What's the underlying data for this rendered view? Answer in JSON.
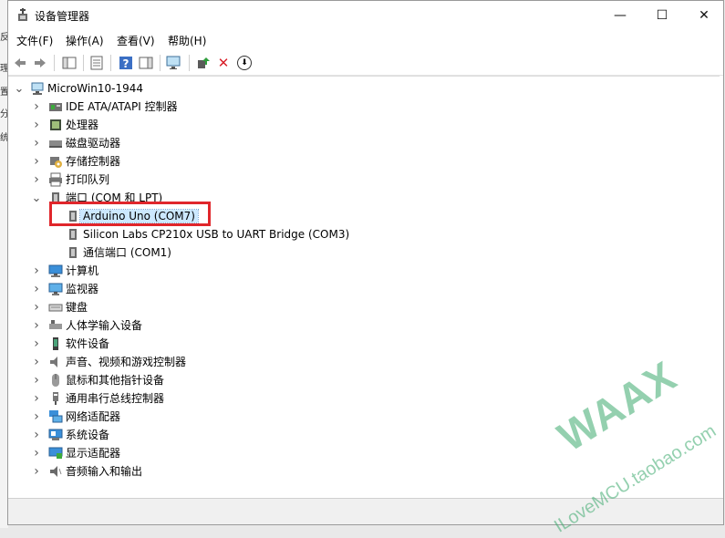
{
  "window": {
    "title": "设备管理器"
  },
  "controls": {
    "minimize": "—",
    "maximize": "☐",
    "close": "✕"
  },
  "menu": [
    "文件(F)",
    "操作(A)",
    "查看(V)",
    "帮助(H)"
  ],
  "edge_chars": [
    "反",
    "理",
    "置",
    "分",
    "统"
  ],
  "toolbar": {
    "icons": [
      "back-arrow-icon",
      "forward-arrow-icon",
      "show-hide-console-tree-icon",
      "properties-icon",
      "help-icon",
      "action-pane-icon",
      "monitor-scan-icon",
      "update-driver-icon",
      "uninstall-device-icon",
      "disable-device-icon"
    ],
    "disable_glyph": "⬇",
    "uninstall_glyph": "✕"
  },
  "tree": {
    "root": "MicroWin10-1944",
    "categories": [
      {
        "label": "IDE ATA/ATAPI 控制器",
        "icon": "ide-controller-icon",
        "expanded": false
      },
      {
        "label": "处理器",
        "icon": "processor-icon",
        "expanded": false
      },
      {
        "label": "磁盘驱动器",
        "icon": "disk-drive-icon",
        "expanded": false
      },
      {
        "label": "存储控制器",
        "icon": "storage-controller-icon",
        "expanded": false
      },
      {
        "label": "打印队列",
        "icon": "printer-icon",
        "expanded": false
      },
      {
        "label": "端口 (COM 和 LPT)",
        "icon": "port-icon",
        "expanded": true,
        "children": [
          {
            "label": "Arduino Uno (COM7)",
            "icon": "port-device-icon",
            "selected": true
          },
          {
            "label": "Silicon Labs CP210x USB to UART Bridge (COM3)",
            "icon": "port-device-icon"
          },
          {
            "label": "通信端口 (COM1)",
            "icon": "port-device-icon"
          }
        ]
      },
      {
        "label": "计算机",
        "icon": "computer-icon",
        "expanded": false
      },
      {
        "label": "监视器",
        "icon": "monitor-icon",
        "expanded": false
      },
      {
        "label": "键盘",
        "icon": "keyboard-icon",
        "expanded": false
      },
      {
        "label": "人体学输入设备",
        "icon": "hid-icon",
        "expanded": false
      },
      {
        "label": "软件设备",
        "icon": "software-device-icon",
        "expanded": false
      },
      {
        "label": "声音、视频和游戏控制器",
        "icon": "sound-icon",
        "expanded": false
      },
      {
        "label": "鼠标和其他指针设备",
        "icon": "mouse-icon",
        "expanded": false
      },
      {
        "label": "通用串行总线控制器",
        "icon": "usb-icon",
        "expanded": false
      },
      {
        "label": "网络适配器",
        "icon": "network-adapter-icon",
        "expanded": false
      },
      {
        "label": "系统设备",
        "icon": "system-device-icon",
        "expanded": false
      },
      {
        "label": "显示适配器",
        "icon": "display-adapter-icon",
        "expanded": false
      },
      {
        "label": "音频输入和输出",
        "icon": "audio-io-icon",
        "expanded": false
      }
    ]
  },
  "watermark": {
    "brand": "WAAX",
    "text": "ILoveMCU.taobao.com",
    "color": "#3caa6e"
  },
  "colors": {
    "highlight_box": "#e0262b",
    "selection": "#cce8ff"
  }
}
